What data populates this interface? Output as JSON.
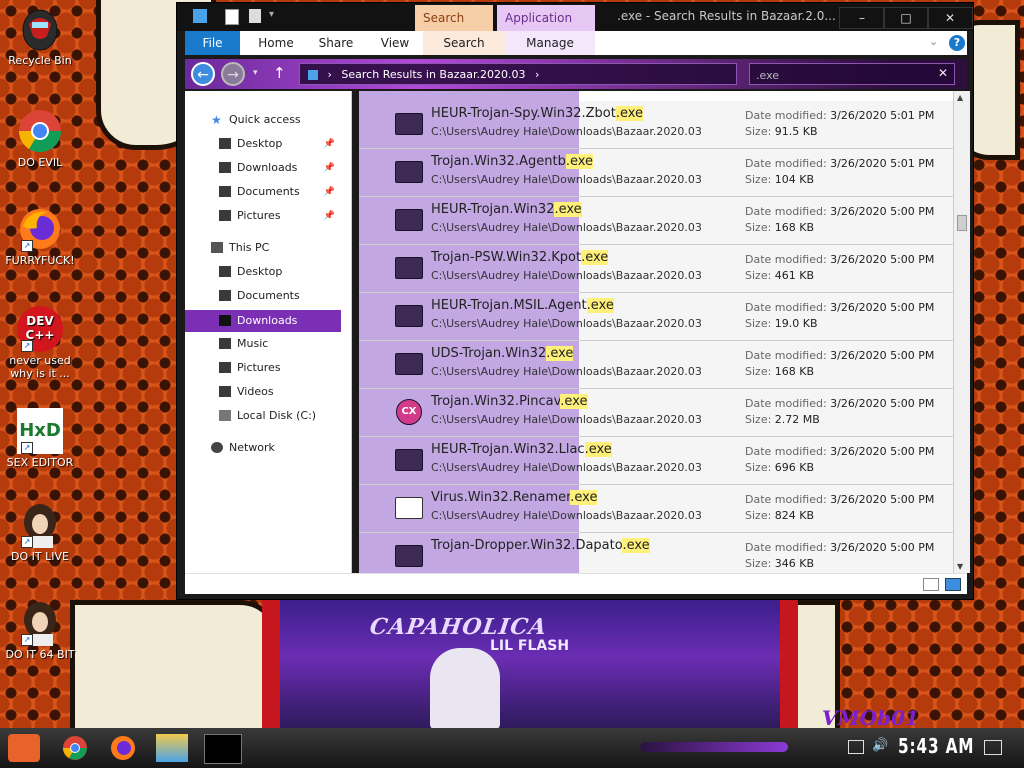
{
  "desktop": {
    "icons": [
      {
        "label": "Recycle Bin"
      },
      {
        "label": "DO EVIL"
      },
      {
        "label": "FURRYFUCK!"
      },
      {
        "label": "never used why is it ..."
      },
      {
        "label": "SEX EDITOR"
      },
      {
        "label": "DO IT LIVE"
      },
      {
        "label": "DO IT 64 BIT"
      }
    ],
    "wallpaper_text": {
      "title": "CAPAHOLICA",
      "subtitle": "LIL FLASH",
      "tag": "VMOb01"
    },
    "devcpp_icon_text": "DEV C++",
    "hxd_icon_text": "HxD"
  },
  "window": {
    "title": ".exe - Search Results in Bazaar.2.0...",
    "context_tabs": {
      "search_tools": "Search Tools",
      "application_tools": "Application Tools"
    },
    "ribbon_tabs": {
      "file": "File",
      "home": "Home",
      "share": "Share",
      "view": "View",
      "search": "Search",
      "manage": "Manage"
    },
    "address": "Search Results in Bazaar.2020.03",
    "search_value": ".exe",
    "controls": {
      "minimize": "–",
      "maximize": "□",
      "close": "✕"
    }
  },
  "nav": {
    "quick_access": "Quick access",
    "qa_items": [
      {
        "label": "Desktop"
      },
      {
        "label": "Downloads"
      },
      {
        "label": "Documents"
      },
      {
        "label": "Pictures"
      }
    ],
    "this_pc": "This PC",
    "pc_items": [
      {
        "label": "Desktop"
      },
      {
        "label": "Documents"
      },
      {
        "label": "Downloads"
      },
      {
        "label": "Music"
      },
      {
        "label": "Pictures"
      },
      {
        "label": "Videos"
      },
      {
        "label": "Local Disk (C:)"
      }
    ],
    "network": "Network"
  },
  "results": [
    {
      "base": "HEUR-Trojan-Spy.Win32.Zbot",
      "ext": ".exe",
      "path": "C:\\Users\\Audrey Hale\\Downloads\\Bazaar.2020.03",
      "date": "3/26/2020 5:01 PM",
      "size": "91.5 KB"
    },
    {
      "base": "Trojan.Win32.Agentb",
      "ext": ".exe",
      "path": "C:\\Users\\Audrey Hale\\Downloads\\Bazaar.2020.03",
      "date": "3/26/2020 5:01 PM",
      "size": "104 KB"
    },
    {
      "base": "HEUR-Trojan.Win32",
      "ext": ".exe",
      "path": "C:\\Users\\Audrey Hale\\Downloads\\Bazaar.2020.03",
      "date": "3/26/2020 5:00 PM",
      "size": "168 KB"
    },
    {
      "base": "Trojan-PSW.Win32.Kpot",
      "ext": ".exe",
      "path": "C:\\Users\\Audrey Hale\\Downloads\\Bazaar.2020.03",
      "date": "3/26/2020 5:00 PM",
      "size": "461 KB"
    },
    {
      "base": "HEUR-Trojan.MSIL.Agent",
      "ext": ".exe",
      "path": "C:\\Users\\Audrey Hale\\Downloads\\Bazaar.2020.03",
      "date": "3/26/2020 5:00 PM",
      "size": "19.0 KB"
    },
    {
      "base": "UDS-Trojan.Win32",
      "ext": ".exe",
      "path": "C:\\Users\\Audrey Hale\\Downloads\\Bazaar.2020.03",
      "date": "3/26/2020 5:00 PM",
      "size": "168 KB"
    },
    {
      "base": "Trojan.Win32.Pincav",
      "ext": ".exe",
      "path": "C:\\Users\\Audrey Hale\\Downloads\\Bazaar.2020.03",
      "date": "3/26/2020 5:00 PM",
      "size": "2.72 MB",
      "icon": "cx-icon"
    },
    {
      "base": "HEUR-Trojan.Win32.Llac",
      "ext": ".exe",
      "path": "C:\\Users\\Audrey Hale\\Downloads\\Bazaar.2020.03",
      "date": "3/26/2020 5:00 PM",
      "size": "696 KB"
    },
    {
      "base": "Virus.Win32.Renamer",
      "ext": ".exe",
      "path": "C:\\Users\\Audrey Hale\\Downloads\\Bazaar.2020.03",
      "date": "3/26/2020 5:00 PM",
      "size": "824 KB",
      "icon": "generic-window-icon"
    },
    {
      "base": "Trojan-Dropper.Win32.Dapato",
      "ext": ".exe",
      "path": "",
      "date": "3/26/2020 5:00 PM",
      "size": "346 KB"
    }
  ],
  "labels": {
    "date_modified": "Date modified:",
    "size": "Size:"
  },
  "taskbar": {
    "clock": "5:43 AM"
  },
  "colors": {
    "accent": "#7a2fb4",
    "selection_band": "#c2a7e3",
    "highlight": "#fff07a",
    "file_tab": "#1979ca"
  }
}
